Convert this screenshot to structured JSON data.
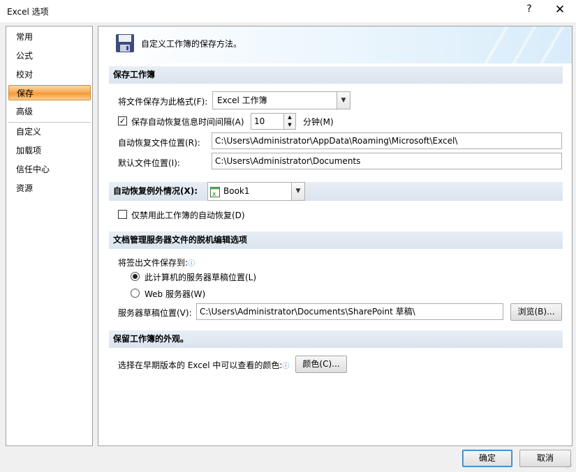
{
  "window": {
    "title": "Excel 选项",
    "help": "?",
    "close": "✕"
  },
  "nav": {
    "items": [
      {
        "label": "常用"
      },
      {
        "label": "公式"
      },
      {
        "label": "校对"
      },
      {
        "label": "保存",
        "selected": true
      },
      {
        "label": "高级"
      },
      {
        "label": "自定义"
      },
      {
        "label": "加载项"
      },
      {
        "label": "信任中心"
      },
      {
        "label": "资源"
      }
    ]
  },
  "banner": {
    "icon": "floppy-disk-icon",
    "text": "自定义工作簿的保存方法。"
  },
  "save_workbooks": {
    "heading": "保存工作簿",
    "format_label": "将文件保存为此格式(F):",
    "format_value": "Excel 工作簿",
    "autorecover_checkbox_label": "保存自动恢复信息时间间隔(A)",
    "autorecover_checked": true,
    "autorecover_minutes": "10",
    "minutes_label": "分钟(M)",
    "autorecover_location_label": "自动恢复文件位置(R):",
    "autorecover_location_value": "C:\\Users\\Administrator\\AppData\\Roaming\\Microsoft\\Excel\\",
    "default_location_label": "默认文件位置(I):",
    "default_location_value": "C:\\Users\\Administrator\\Documents"
  },
  "autorecover_exceptions": {
    "heading": "自动恢复例外情况(X):",
    "workbook_value": "Book1",
    "disable_label": "仅禁用此工作簿的自动恢复(D)",
    "disable_checked": false
  },
  "offline_editing": {
    "heading": "文档管理服务器文件的脱机编辑选项",
    "checkout_label": "将签出文件保存到:",
    "option_local_label": "此计算机的服务器草稿位置(L)",
    "option_web_label": "Web 服务器(W)",
    "selected_option": "local",
    "drafts_label": "服务器草稿位置(V):",
    "drafts_value": "C:\\Users\\Administrator\\Documents\\SharePoint 草稿\\",
    "browse_label": "浏览(B)..."
  },
  "appearance": {
    "heading": "保留工作簿的外观。",
    "colors_label": "选择在早期版本的 Excel 中可以查看的颜色:",
    "colors_button": "颜色(C)..."
  },
  "footer": {
    "ok_label": "确定",
    "cancel_label": "取消"
  },
  "colors": {
    "nav_selected": "#f7ac5a",
    "section_header": "#dbe4ee",
    "info": "#1e74c9"
  }
}
